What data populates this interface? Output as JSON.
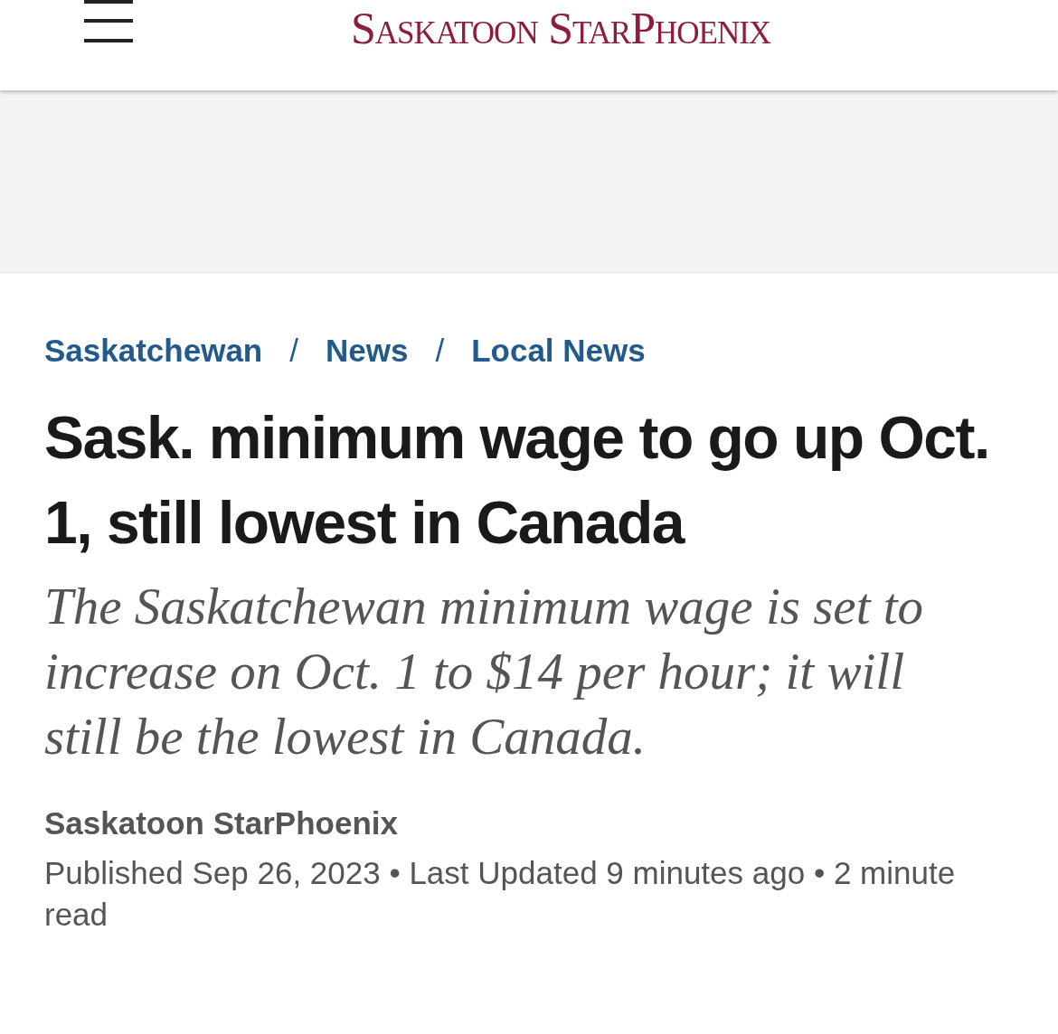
{
  "header": {
    "logo": "Saskatoon StarPhoenix"
  },
  "breadcrumbs": [
    {
      "label": "Saskatchewan"
    },
    {
      "label": "News"
    },
    {
      "label": "Local News"
    }
  ],
  "breadcrumb_separator": "/",
  "article": {
    "headline": "Sask. minimum wage to go up Oct. 1, still lowest in Canada",
    "deck": "The Saskatchewan minimum wage is set to increase on Oct. 1 to $14 per hour; it will still be the lowest in Canada.",
    "author": "Saskatoon StarPhoenix",
    "meta": [
      "Published Sep 26, 2023",
      "Last Updated 9 minutes ago",
      "2 minute read"
    ],
    "meta_separator": "•"
  }
}
